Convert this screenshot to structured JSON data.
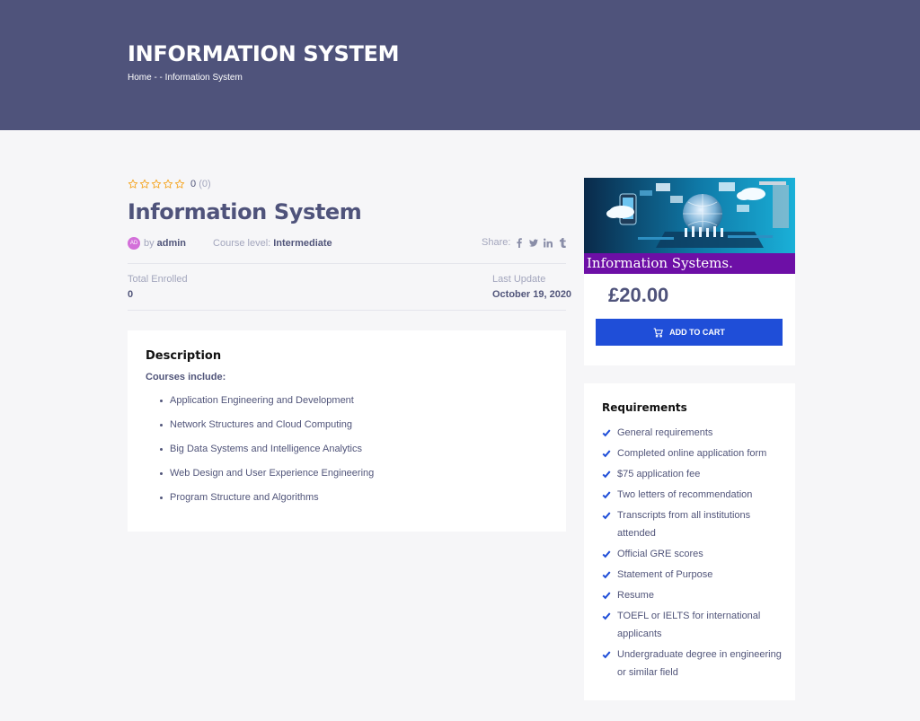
{
  "header": {
    "title": "INFORMATION SYSTEM",
    "breadcrumb": "Home - - Information System"
  },
  "course": {
    "rating": {
      "stars": 0,
      "max": 5,
      "count": "0",
      "count_paren": "(0)"
    },
    "title": "Information System",
    "avatar_initials": "AD",
    "by_label": "by",
    "author": "admin",
    "level_label": "Course level:",
    "level": "Intermediate",
    "share_label": "Share:",
    "share_icons": [
      "facebook-icon",
      "twitter-icon",
      "linkedin-icon",
      "tumblr-icon"
    ],
    "enrolled_label": "Total Enrolled",
    "enrolled": "0",
    "updated_label": "Last Update",
    "updated": "October 19, 2020"
  },
  "description": {
    "title": "Description",
    "subtitle": "Courses include:",
    "items": [
      "Application Engineering and Development",
      "Network Structures and Cloud Computing",
      "Big Data Systems and Intelligence Analytics",
      "Web Design and User Experience Engineering",
      "Program Structure and Algorithms"
    ]
  },
  "sidebar": {
    "thumbnail_caption": "Information Systems.",
    "price": "£20.00",
    "add_to_cart": "ADD TO CART",
    "requirements_title": "Requirements",
    "requirements": [
      "General requirements",
      "Completed online application form",
      "$75 application fee",
      "Two letters of recommendation",
      "Transcripts from all institutions attended",
      "Official GRE scores",
      "Statement of Purpose",
      "Resume",
      "TOEFL or IELTS for international applicants",
      "Undergraduate degree in engineering or similar field"
    ]
  },
  "colors": {
    "hero": "#4f537b",
    "accent": "#1f4ed8",
    "star": "#f5a623",
    "thumb_banner": "#6d0fa6"
  }
}
